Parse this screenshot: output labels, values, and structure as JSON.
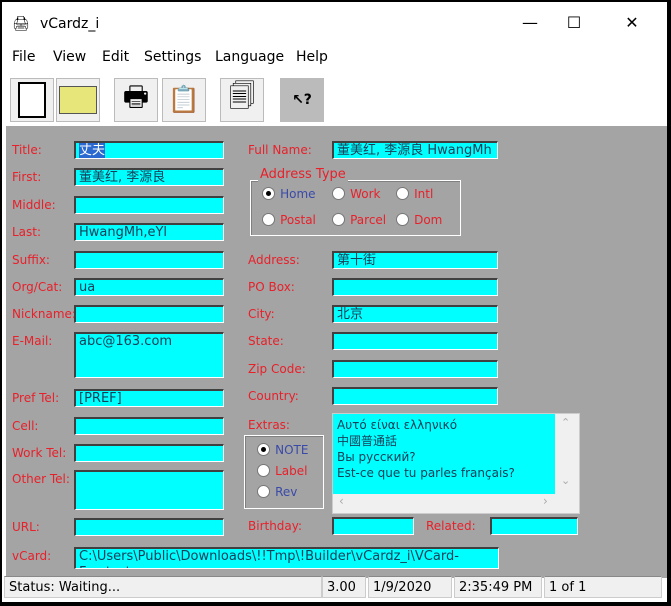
{
  "window": {
    "title": "vCardz_i",
    "minimize": "—",
    "maximize": "☐",
    "close": "✕"
  },
  "menu": [
    "File",
    "View",
    "Edit",
    "Settings",
    "Language",
    "Help"
  ],
  "toolbar": [
    "new-file",
    "open-folder",
    "print",
    "paste",
    "copy",
    "help"
  ],
  "fields": {
    "title": {
      "label": "Title:",
      "value": "丈夫"
    },
    "first": {
      "label": "First:",
      "value": "董美红, 李源良"
    },
    "middle": {
      "label": "Middle:",
      "value": ""
    },
    "last": {
      "label": "Last:",
      "value": "HwangMh,eYl"
    },
    "suffix": {
      "label": "Suffix:",
      "value": ""
    },
    "org": {
      "label": "Org/Cat:",
      "value": "ua"
    },
    "nickname": {
      "label": "Nickname:",
      "value": ""
    },
    "email": {
      "label": "E-Mail:",
      "value": "abc@163.com"
    },
    "pref_tel": {
      "label": "Pref Tel:",
      "value": "   [PREF]"
    },
    "cell": {
      "label": "Cell:",
      "value": ""
    },
    "work_tel": {
      "label": "Work Tel:",
      "value": ""
    },
    "other_tel": {
      "label": "Other Tel:",
      "value": ""
    },
    "url": {
      "label": "URL:",
      "value": ""
    },
    "vcard": {
      "label": "vCard:",
      "value": "C:\\Users\\Public\\Downloads\\!!Tmp\\!Builder\\vCardz_i\\VCard-For_tests"
    },
    "full_name": {
      "label": "Full Name:",
      "value": "董美红, 李源良 HwangMh"
    },
    "address": {
      "label": "Address:",
      "value": "第十街"
    },
    "po_box": {
      "label": "PO Box:",
      "value": ""
    },
    "city": {
      "label": "City:",
      "value": "北京"
    },
    "state": {
      "label": "State:",
      "value": ""
    },
    "zip": {
      "label": "Zip Code:",
      "value": ""
    },
    "country": {
      "label": "Country:",
      "value": ""
    },
    "birthday": {
      "label": "Birthday:",
      "value": ""
    },
    "related": {
      "label": "Related:",
      "value": ""
    }
  },
  "address_type": {
    "legend": "Address Type",
    "options": [
      "Home",
      "Work",
      "Intl",
      "Postal",
      "Parcel",
      "Dom"
    ],
    "selected": "Home"
  },
  "extras": {
    "label": "Extras:",
    "options": [
      "NOTE",
      "Label",
      "Rev"
    ],
    "selected": "NOTE",
    "lines": [
      "Αυτό είναι ελληνικό",
      "中國普通話",
      "Вы русский?",
      "Est-ce que tu parles français?"
    ]
  },
  "status": {
    "text": "Status: Waiting...",
    "version": "3.00",
    "date": "1/9/2020",
    "time": "2:35:49 PM",
    "record": "1 of 1"
  }
}
